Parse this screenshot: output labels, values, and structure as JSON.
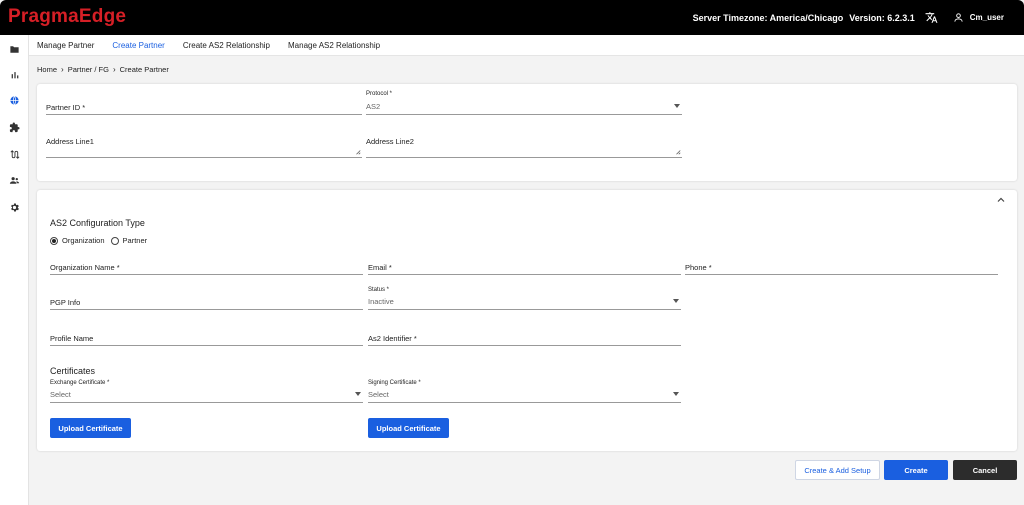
{
  "brand": {
    "logo_text": "PragmaEdge",
    "logo_color": "#d61f26"
  },
  "header": {
    "timezone": "Server Timezone: America/Chicago",
    "version": "Version: 6.2.3.1",
    "user": "Cm_user"
  },
  "sidebar": {
    "icons": [
      "file-icon",
      "bar-chart-icon",
      "globe-icon",
      "puzzle-icon",
      "route-icon",
      "users-icon",
      "gear-icon"
    ]
  },
  "subnav": {
    "items": [
      "Manage Partner",
      "Create Partner",
      "Create AS2 Relationship",
      "Manage AS2 Relationship"
    ],
    "active": "Create Partner"
  },
  "breadcrumb": [
    "Home",
    "Partner / FG",
    "Create Partner"
  ],
  "partner_form": {
    "partner_id_label": "Partner ID *",
    "protocol_label": "Protocol *",
    "protocol_value": "AS2",
    "address1_label": "Address Line1",
    "address2_label": "Address Line2"
  },
  "as2_config": {
    "title": "AS2 Configuration Type",
    "options": [
      "Organization",
      "Partner"
    ],
    "selected": "Organization",
    "org_name_label": "Organization Name *",
    "email_label": "Email *",
    "phone_label": "Phone *",
    "pgp_label": "PGP Info",
    "status_label": "Status *",
    "status_value": "Inactive",
    "profile_label": "Profile Name",
    "as2_identifier_label": "As2 Identifier *",
    "certificates_title": "Certificates",
    "exchange_cert_label": "Exchange Certificate *",
    "exchange_cert_value": "Select",
    "signing_cert_label": "Signing Certificate *",
    "signing_cert_value": "Select",
    "upload_label_1": "Upload Certificate",
    "upload_label_2": "Upload Certificate"
  },
  "actions": {
    "create_add_setup": "Create & Add Setup",
    "create": "Create",
    "cancel": "Cancel"
  },
  "colors": {
    "primary": "#1a5fe0",
    "dark_button": "#2c2c2c",
    "topbar": "#000000"
  }
}
